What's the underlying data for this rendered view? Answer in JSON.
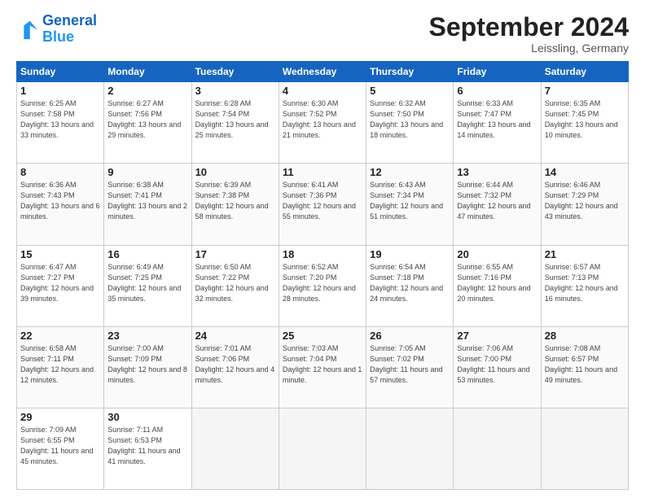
{
  "header": {
    "logo_line1": "General",
    "logo_line2": "Blue",
    "month": "September 2024",
    "location": "Leissling, Germany"
  },
  "weekdays": [
    "Sunday",
    "Monday",
    "Tuesday",
    "Wednesday",
    "Thursday",
    "Friday",
    "Saturday"
  ],
  "weeks": [
    [
      {
        "day": "1",
        "sunrise": "6:25 AM",
        "sunset": "7:58 PM",
        "daylight": "13 hours and 33 minutes."
      },
      {
        "day": "2",
        "sunrise": "6:27 AM",
        "sunset": "7:56 PM",
        "daylight": "13 hours and 29 minutes."
      },
      {
        "day": "3",
        "sunrise": "6:28 AM",
        "sunset": "7:54 PM",
        "daylight": "13 hours and 25 minutes."
      },
      {
        "day": "4",
        "sunrise": "6:30 AM",
        "sunset": "7:52 PM",
        "daylight": "13 hours and 21 minutes."
      },
      {
        "day": "5",
        "sunrise": "6:32 AM",
        "sunset": "7:50 PM",
        "daylight": "13 hours and 18 minutes."
      },
      {
        "day": "6",
        "sunrise": "6:33 AM",
        "sunset": "7:47 PM",
        "daylight": "13 hours and 14 minutes."
      },
      {
        "day": "7",
        "sunrise": "6:35 AM",
        "sunset": "7:45 PM",
        "daylight": "13 hours and 10 minutes."
      }
    ],
    [
      {
        "day": "8",
        "sunrise": "6:36 AM",
        "sunset": "7:43 PM",
        "daylight": "13 hours and 6 minutes."
      },
      {
        "day": "9",
        "sunrise": "6:38 AM",
        "sunset": "7:41 PM",
        "daylight": "13 hours and 2 minutes."
      },
      {
        "day": "10",
        "sunrise": "6:39 AM",
        "sunset": "7:38 PM",
        "daylight": "12 hours and 58 minutes."
      },
      {
        "day": "11",
        "sunrise": "6:41 AM",
        "sunset": "7:36 PM",
        "daylight": "12 hours and 55 minutes."
      },
      {
        "day": "12",
        "sunrise": "6:43 AM",
        "sunset": "7:34 PM",
        "daylight": "12 hours and 51 minutes."
      },
      {
        "day": "13",
        "sunrise": "6:44 AM",
        "sunset": "7:32 PM",
        "daylight": "12 hours and 47 minutes."
      },
      {
        "day": "14",
        "sunrise": "6:46 AM",
        "sunset": "7:29 PM",
        "daylight": "12 hours and 43 minutes."
      }
    ],
    [
      {
        "day": "15",
        "sunrise": "6:47 AM",
        "sunset": "7:27 PM",
        "daylight": "12 hours and 39 minutes."
      },
      {
        "day": "16",
        "sunrise": "6:49 AM",
        "sunset": "7:25 PM",
        "daylight": "12 hours and 35 minutes."
      },
      {
        "day": "17",
        "sunrise": "6:50 AM",
        "sunset": "7:22 PM",
        "daylight": "12 hours and 32 minutes."
      },
      {
        "day": "18",
        "sunrise": "6:52 AM",
        "sunset": "7:20 PM",
        "daylight": "12 hours and 28 minutes."
      },
      {
        "day": "19",
        "sunrise": "6:54 AM",
        "sunset": "7:18 PM",
        "daylight": "12 hours and 24 minutes."
      },
      {
        "day": "20",
        "sunrise": "6:55 AM",
        "sunset": "7:16 PM",
        "daylight": "12 hours and 20 minutes."
      },
      {
        "day": "21",
        "sunrise": "6:57 AM",
        "sunset": "7:13 PM",
        "daylight": "12 hours and 16 minutes."
      }
    ],
    [
      {
        "day": "22",
        "sunrise": "6:58 AM",
        "sunset": "7:11 PM",
        "daylight": "12 hours and 12 minutes."
      },
      {
        "day": "23",
        "sunrise": "7:00 AM",
        "sunset": "7:09 PM",
        "daylight": "12 hours and 8 minutes."
      },
      {
        "day": "24",
        "sunrise": "7:01 AM",
        "sunset": "7:06 PM",
        "daylight": "12 hours and 4 minutes."
      },
      {
        "day": "25",
        "sunrise": "7:03 AM",
        "sunset": "7:04 PM",
        "daylight": "12 hours and 1 minute."
      },
      {
        "day": "26",
        "sunrise": "7:05 AM",
        "sunset": "7:02 PM",
        "daylight": "11 hours and 57 minutes."
      },
      {
        "day": "27",
        "sunrise": "7:06 AM",
        "sunset": "7:00 PM",
        "daylight": "11 hours and 53 minutes."
      },
      {
        "day": "28",
        "sunrise": "7:08 AM",
        "sunset": "6:57 PM",
        "daylight": "11 hours and 49 minutes."
      }
    ],
    [
      {
        "day": "29",
        "sunrise": "7:09 AM",
        "sunset": "6:55 PM",
        "daylight": "11 hours and 45 minutes."
      },
      {
        "day": "30",
        "sunrise": "7:11 AM",
        "sunset": "6:53 PM",
        "daylight": "11 hours and 41 minutes."
      },
      null,
      null,
      null,
      null,
      null
    ]
  ]
}
